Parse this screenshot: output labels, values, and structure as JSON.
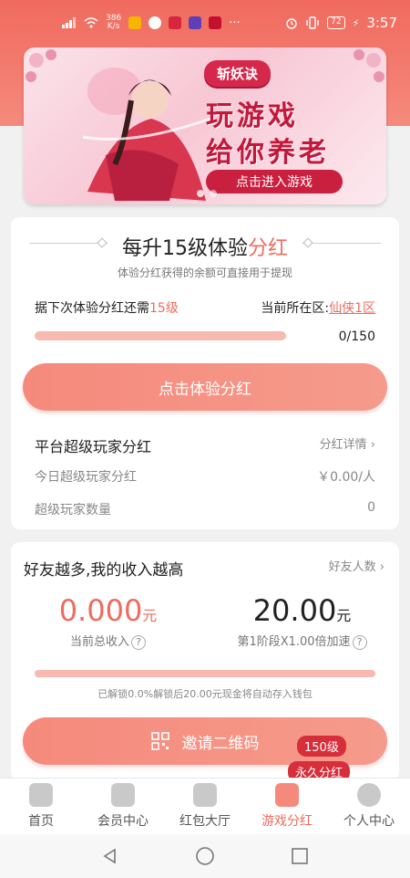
{
  "status_bar": {
    "speed_top": "386",
    "speed_unit": "K/s",
    "battery": "72",
    "time": "3:57"
  },
  "banner": {
    "badge": "斩妖诀",
    "slogan_line1": "玩游戏",
    "slogan_line2": "给你养老",
    "enter_button": "点击进入游戏"
  },
  "experience_card": {
    "title_prefix": "每升15级体验",
    "title_accent": "分红",
    "subtitle": "体验分红获得的余额可直接用于提现",
    "next_label_prefix": "据下次体验分红还需",
    "next_label_accent": "15级",
    "region_prefix": "当前所在区:",
    "region_link": "仙侠1区",
    "progress_value": 0,
    "progress_max": 150,
    "progress_text": "0/150",
    "button_label": "点击体验分红"
  },
  "super_player": {
    "title": "平台超级玩家分红",
    "detail_link": "分红详情",
    "today_label": "今日超级玩家分红",
    "today_value": "￥0.00/人",
    "count_label": "超级玩家数量",
    "count_value": "0"
  },
  "friends_card": {
    "title": "好友越多,我的收入越高",
    "friends_link": "好友人数",
    "total_income": "0.000",
    "total_income_unit": "元",
    "total_income_label": "当前总收入",
    "stage_amount": "20.00",
    "stage_amount_unit": "元",
    "stage_label": "第1阶段X1.00倍加速",
    "unlock_percent": 0.0,
    "unlock_note": "已解锁0.0%解锁后20.00元现金将自动存入钱包",
    "invite_button": "邀请二维码",
    "tag_level": "150级",
    "tag_permanent": "永久分红"
  },
  "tabs": [
    {
      "label": "首页",
      "icon": "home-icon"
    },
    {
      "label": "会员中心",
      "icon": "crown-icon"
    },
    {
      "label": "红包大厅",
      "icon": "red-packet-icon"
    },
    {
      "label": "游戏分红",
      "icon": "game-hand-icon",
      "active": true
    },
    {
      "label": "个人中心",
      "icon": "profile-icon"
    }
  ],
  "colors": {
    "accent": "#ef6b5e",
    "accent_light": "#f58a7c",
    "track": "#f8b9b0"
  }
}
